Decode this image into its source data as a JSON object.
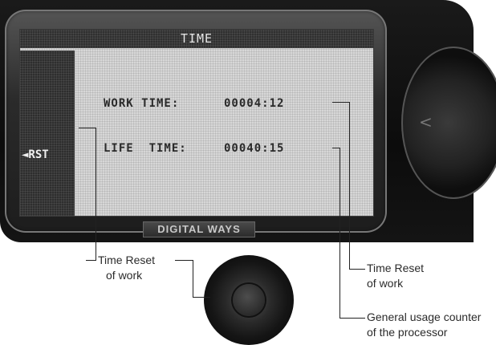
{
  "screen": {
    "title": "TIME",
    "side_label": "◄RST",
    "rows": [
      {
        "label": "WORK TIME:",
        "value": "00004:12"
      },
      {
        "label": "LIFE  TIME:",
        "value": "00040:15"
      }
    ]
  },
  "device": {
    "brand": "DIGITAL WAYS"
  },
  "callouts": {
    "left": {
      "line1": "Time Reset",
      "line2": "of work"
    },
    "right_top": {
      "line1": "Time Reset",
      "line2": "of work"
    },
    "right_bottom": {
      "line1": "General usage counter",
      "line2": "of the processor"
    }
  },
  "icons": {
    "knob_arrow": "<"
  }
}
